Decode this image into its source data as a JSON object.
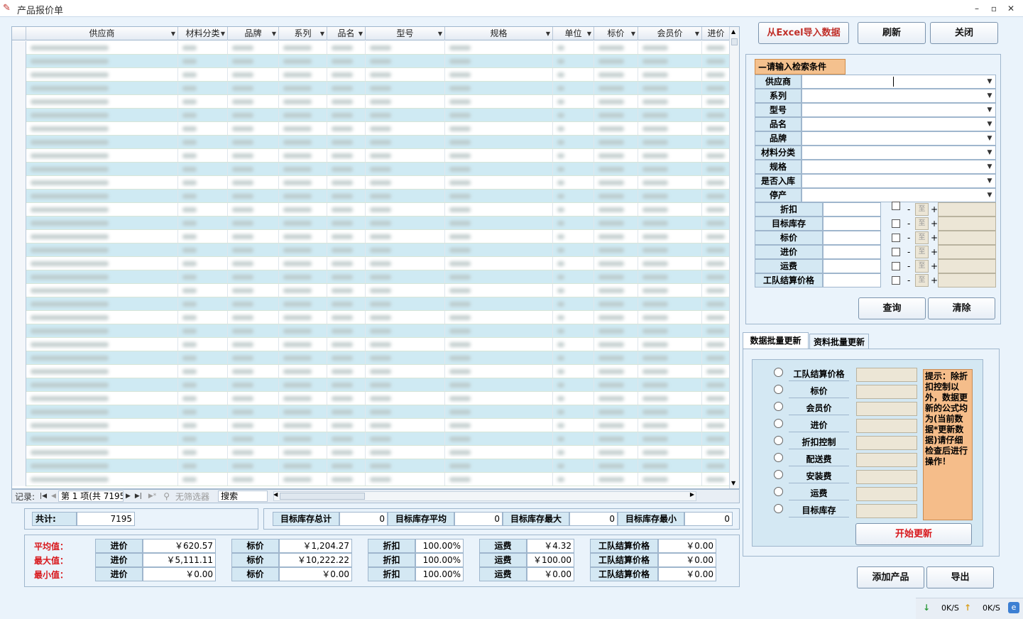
{
  "window": {
    "title": "产品报价单",
    "min": "–",
    "max": "▫",
    "close": "✕"
  },
  "toolbar": {
    "import_excel": "从Excel导入数据",
    "refresh": "刷新",
    "close": "关闭"
  },
  "grid": {
    "columns": [
      {
        "label": "供应商"
      },
      {
        "label": "材料分类"
      },
      {
        "label": "品牌"
      },
      {
        "label": "系列"
      },
      {
        "label": "品名"
      },
      {
        "label": "型号"
      },
      {
        "label": "规格"
      },
      {
        "label": "单位"
      },
      {
        "label": "标价"
      },
      {
        "label": "会员价"
      },
      {
        "label": "进价"
      }
    ],
    "visible_rows": 33,
    "note_blurred": true
  },
  "nav": {
    "record_label": "记录:",
    "record_text": "第 1 项(共 7195",
    "filter": "无筛选器",
    "search": "搜索"
  },
  "summary": {
    "total_label": "共计:",
    "total_value": "7195",
    "stock_total_label": "目标库存总计",
    "stock_total": "0",
    "stock_avg_label": "目标库存平均",
    "stock_avg": "0",
    "stock_max_label": "目标库存最大",
    "stock_max": "0",
    "stock_min_label": "目标库存最小",
    "stock_min": "0"
  },
  "stats": {
    "avg_label": "平均值：",
    "max_label": "最大值：",
    "min_label": "最小值：",
    "col_jinjia": "进价",
    "col_biaojia": "标价",
    "col_zhekou": "折扣",
    "col_yunfei": "运费",
    "col_gongdui": "工队结算价格",
    "avg": {
      "jinjia": "￥620.57",
      "biaojia": "￥1,204.27",
      "zhekou": "100.00%",
      "yunfei": "￥4.32",
      "gongdui": "￥0.00"
    },
    "max": {
      "jinjia": "￥5,111.11",
      "biaojia": "￥10,222.22",
      "zhekou": "100.00%",
      "yunfei": "￥100.00",
      "gongdui": "￥0.00"
    },
    "min": {
      "jinjia": "￥0.00",
      "biaojia": "￥0.00",
      "zhekou": "100.00%",
      "yunfei": "￥0.00",
      "gongdui": "￥0.00"
    }
  },
  "search": {
    "heading": "请输入检索条件",
    "fields": [
      "供应商",
      "系列",
      "型号",
      "品名",
      "品牌",
      "材料分类",
      "规格",
      "是否入库",
      "停产"
    ],
    "num_fields": [
      "折扣",
      "目标库存",
      "标价",
      "进价",
      "运费",
      "工队结算价格"
    ],
    "dash": "-",
    "to": "至",
    "plus": "+",
    "query": "查询",
    "clear": "清除"
  },
  "tabs": {
    "data_update": "数据批量更新",
    "info_update": "资料批量更新"
  },
  "update": {
    "options": [
      "工队结算价格",
      "标价",
      "会员价",
      "进价",
      "折扣控制",
      "配送费",
      "安装费",
      "运费",
      "目标库存"
    ],
    "tip": "提示：除折扣控制以外，数据更新的公式均为(当前数据*更新数据)请仔细检查后进行操作！",
    "start": "开始更新"
  },
  "actions": {
    "add_product": "添加产品",
    "export": "导出"
  },
  "status": {
    "down_speed": "0K/S",
    "up_speed": "0K/S"
  },
  "colors": {
    "accent_red": "#d8171b",
    "row_alt": "#cfeaf3",
    "tip_bg": "#f5bd8a"
  }
}
